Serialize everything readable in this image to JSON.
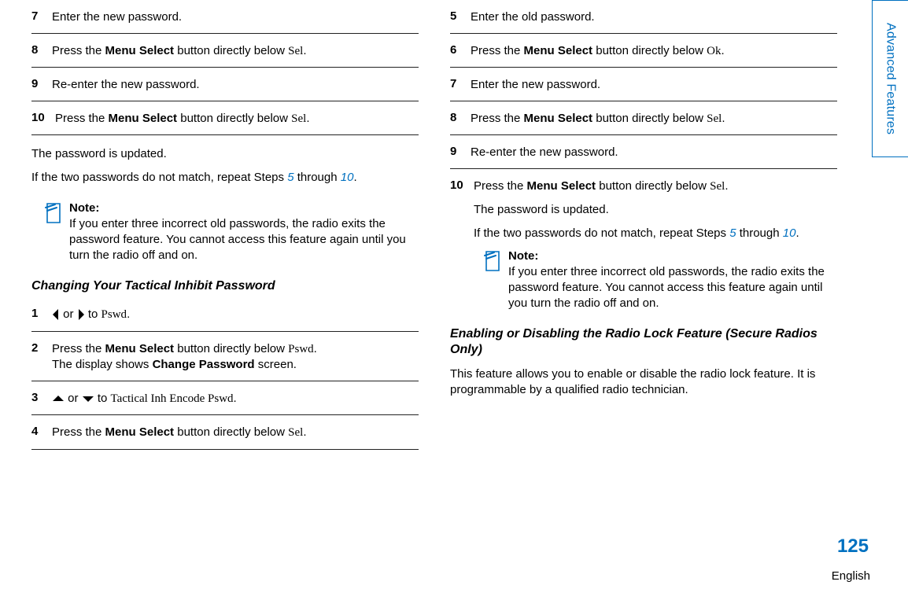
{
  "sideTab": "Advanced Features",
  "pageNumber": "125",
  "language": "English",
  "left": {
    "steps1": [
      {
        "num": "7",
        "text_plain": "Enter the new password."
      },
      {
        "num": "8",
        "parts": [
          "Press the ",
          {
            "b": "Menu Select"
          },
          " button directly below ",
          {
            "m": "Sel"
          },
          "."
        ]
      },
      {
        "num": "9",
        "text_plain": "Re-enter the new password."
      },
      {
        "num": "10",
        "parts": [
          "Press the ",
          {
            "b": "Menu Select"
          },
          " button directly below ",
          {
            "m": "Sel"
          },
          "."
        ]
      }
    ],
    "after1": {
      "p1": "The password is updated.",
      "p2_pre": "If the two passwords do not match, repeat Steps ",
      "link1": "5",
      "mid": " through ",
      "link2": "10",
      "post": "."
    },
    "note1": {
      "title": "Note:",
      "body": "If you enter three incorrect old passwords, the radio exits the password feature. You cannot access this feature again until you turn the radio off and on."
    },
    "section2": "Changing Your Tactical Inhibit Password",
    "steps2": [
      {
        "num": "1",
        "leftright": true,
        "after": " to ",
        "m": "Pswd",
        "tail": "."
      },
      {
        "num": "2",
        "line1_parts": [
          "Press the ",
          {
            "b": "Menu Select"
          },
          " button directly below ",
          {
            "m": "Pswd"
          },
          "."
        ],
        "line2_parts": [
          "The display shows ",
          {
            "b": "Change Password"
          },
          " screen."
        ]
      },
      {
        "num": "3",
        "updown": true,
        "after": " to ",
        "m": "Tactical Inh Encode Pswd",
        "tail": "."
      },
      {
        "num": "4",
        "parts": [
          "Press the ",
          {
            "b": "Menu Select"
          },
          " button directly below ",
          {
            "m": "Sel"
          },
          "."
        ]
      }
    ]
  },
  "right": {
    "steps1": [
      {
        "num": "5",
        "text_plain": "Enter the old password."
      },
      {
        "num": "6",
        "parts": [
          "Press the ",
          {
            "b": "Menu Select"
          },
          " button directly below ",
          {
            "m": "Ok"
          },
          "."
        ]
      },
      {
        "num": "7",
        "text_plain": "Enter the new password."
      },
      {
        "num": "8",
        "parts": [
          "Press the ",
          {
            "b": "Menu Select"
          },
          " button directly below ",
          {
            "m": "Sel"
          },
          "."
        ]
      },
      {
        "num": "9",
        "text_plain": "Re-enter the new password."
      }
    ],
    "step10": {
      "num": "10",
      "parts": [
        "Press the ",
        {
          "b": "Menu Select"
        },
        " button directly below ",
        {
          "m": "Sel"
        },
        "."
      ],
      "p1": "The password is updated.",
      "p2_pre": "If the two passwords do not match, repeat Steps ",
      "link1": "5",
      "mid": " through ",
      "link2": "10",
      "post": "."
    },
    "note1": {
      "title": "Note:",
      "body": "If you enter three incorrect old passwords, the radio exits the password feature. You cannot access this feature again until you turn the radio off and on."
    },
    "section2": "Enabling or Disabling the Radio Lock Feature (Secure Radios Only)",
    "paragraph": "This feature allows you to enable or disable the radio lock feature. It is programmable by a qualified radio technician."
  }
}
